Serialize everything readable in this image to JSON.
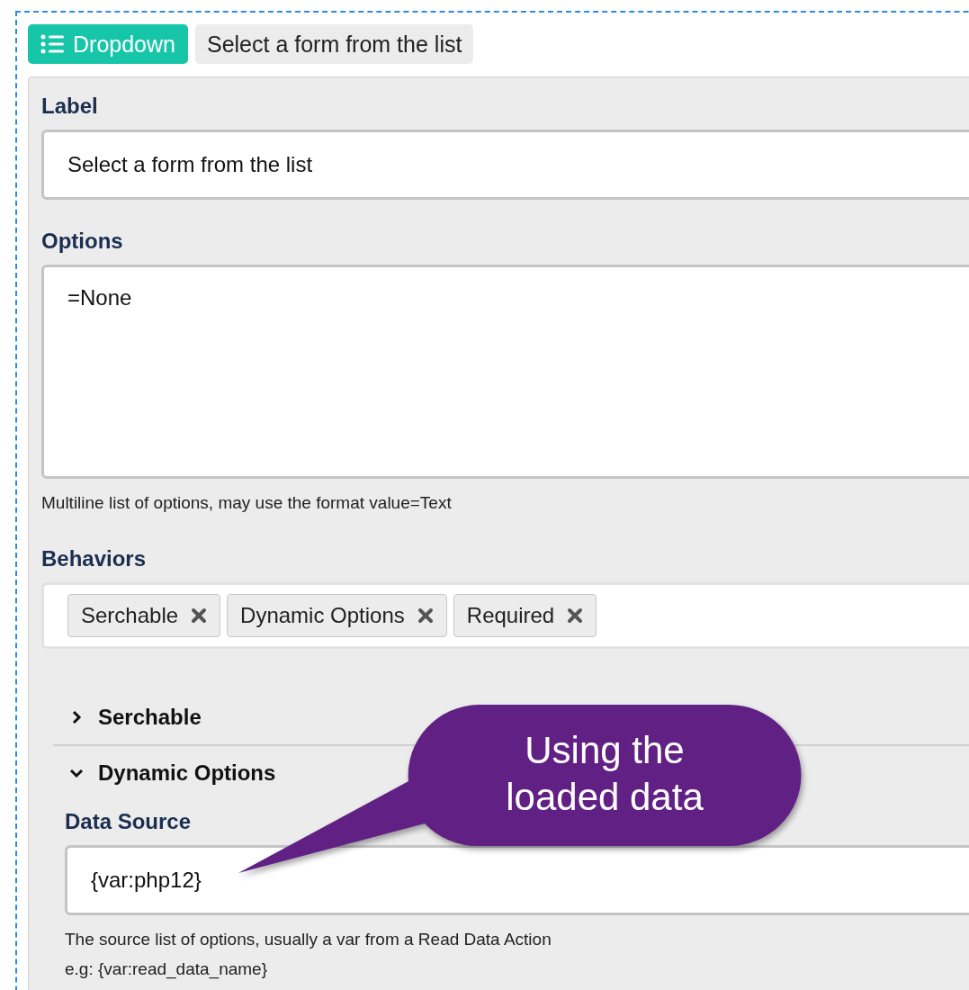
{
  "header": {
    "type_badge": "Dropdown",
    "title": "Select a form from the list"
  },
  "fields": [
    {
      "label": "Label",
      "kind": "input",
      "value": "Select a form from the list"
    },
    {
      "label": "Options",
      "kind": "textarea",
      "value": "=None",
      "hints": [
        "Multiline list of options, may use the format value=Text"
      ]
    }
  ],
  "behaviors": {
    "label": "Behaviors",
    "tags": [
      "Serchable",
      "Dynamic Options",
      "Required"
    ]
  },
  "sections": [
    {
      "title": "Serchable",
      "expanded": false
    },
    {
      "title": "Dynamic Options",
      "expanded": true,
      "fields": [
        {
          "label": "Data Source",
          "kind": "input",
          "value": "{var:php12}",
          "hints": [
            "The source list of options, usually a var from a Read Data Action",
            "e.g: {var:read_data_name}"
          ]
        }
      ]
    }
  ],
  "callout": {
    "lines": [
      "Using the",
      "loaded data"
    ]
  }
}
